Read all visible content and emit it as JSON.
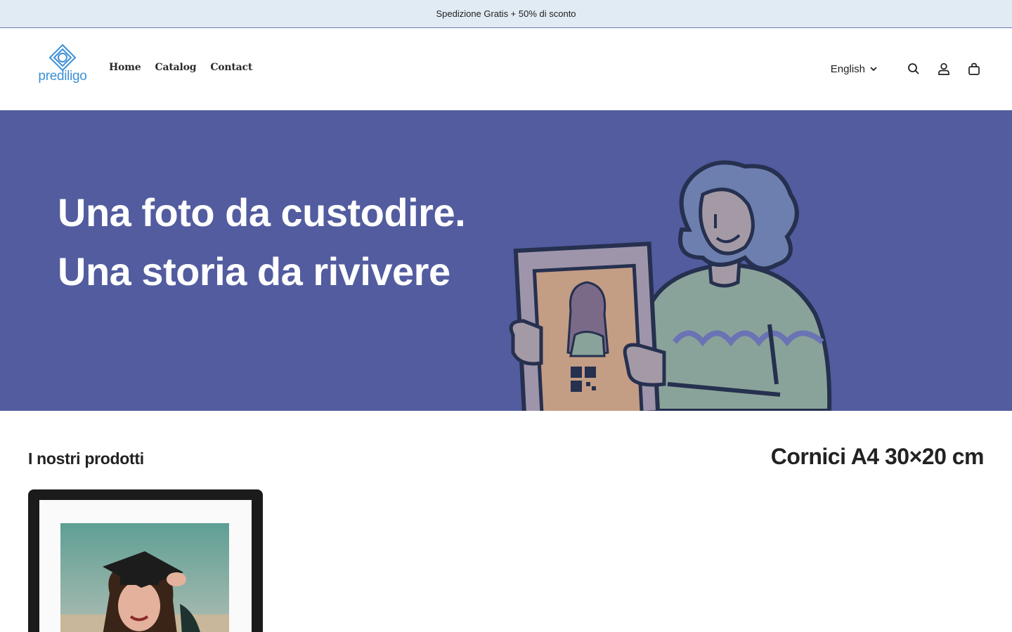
{
  "announcement": {
    "text": "Spedizione Gratis + 50% di sconto"
  },
  "header": {
    "logo_text": "prediligo",
    "nav": [
      {
        "label": "Home"
      },
      {
        "label": "Catalog"
      },
      {
        "label": "Contact"
      }
    ],
    "language": "English",
    "icons": [
      "search-icon",
      "account-icon",
      "cart-icon"
    ]
  },
  "hero": {
    "line1": "Una foto da custodire.",
    "line2": "Una storia da rivivere",
    "background_color": "#525c9f"
  },
  "products": {
    "section_title": "I nostri prodotti",
    "collection_title": "Cornici A4 30×20 cm"
  },
  "colors": {
    "accent": "#3d8fd6",
    "announcement_bg": "#e1ebf3",
    "text": "#1f1f1f"
  }
}
